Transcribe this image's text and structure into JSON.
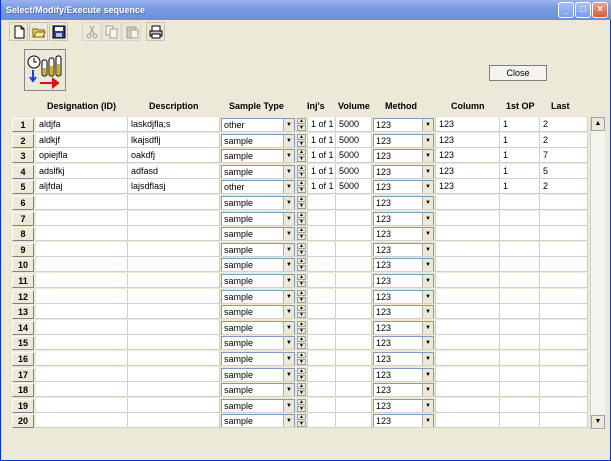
{
  "window": {
    "title": "Select/Modify/Execute sequence"
  },
  "titlebar_buttons": {
    "minimize": "_",
    "maximize": "□",
    "close": "×"
  },
  "toolbar": {
    "buttons": [
      {
        "name": "new-icon",
        "enabled": true
      },
      {
        "name": "open-icon",
        "enabled": true
      },
      {
        "name": "save-icon",
        "enabled": true
      },
      {
        "name": "cut-icon",
        "enabled": false
      },
      {
        "name": "copy-icon",
        "enabled": false
      },
      {
        "name": "paste-icon",
        "enabled": false
      },
      {
        "name": "print-icon",
        "enabled": true
      }
    ]
  },
  "close_button": {
    "label": "Close"
  },
  "columns": {
    "designation": "Designation (ID)",
    "description": "Description",
    "sample_type": "Sample Type",
    "injs": "Inj's",
    "volume": "Volume",
    "method": "Method",
    "column": "Column",
    "first_op": "1st OP",
    "last": "Last"
  },
  "rows": [
    {
      "num": "1",
      "designation": "aldjfa",
      "description": "laskdjfla;s",
      "sample_type": "other",
      "injs": "1 of 1",
      "volume": "5000",
      "method": "123",
      "column": "123",
      "first_op": "1",
      "last": "2"
    },
    {
      "num": "2",
      "designation": "aldkjf",
      "description": "lkajsdflj",
      "sample_type": "sample",
      "injs": "1 of 1",
      "volume": "5000",
      "method": "123",
      "column": "123",
      "first_op": "1",
      "last": "2"
    },
    {
      "num": "3",
      "designation": "opiejfla",
      "description": "oakdfj",
      "sample_type": "sample",
      "injs": "1 of 1",
      "volume": "5000",
      "method": "123",
      "column": "123",
      "first_op": "1",
      "last": "7"
    },
    {
      "num": "4",
      "designation": "adslfkj",
      "description": "adfasd",
      "sample_type": "sample",
      "injs": "1 of 1",
      "volume": "5000",
      "method": "123",
      "column": "123",
      "first_op": "1",
      "last": "5"
    },
    {
      "num": "5",
      "designation": "aljfdaj",
      "description": "lajsdflasj",
      "sample_type": "other",
      "injs": "1 of 1",
      "volume": "5000",
      "method": "123",
      "column": "123",
      "first_op": "1",
      "last": "2"
    },
    {
      "num": "6",
      "designation": "",
      "description": "",
      "sample_type": "sample",
      "injs": "",
      "volume": "",
      "method": "123",
      "column": "",
      "first_op": "",
      "last": ""
    },
    {
      "num": "7",
      "designation": "",
      "description": "",
      "sample_type": "sample",
      "injs": "",
      "volume": "",
      "method": "123",
      "column": "",
      "first_op": "",
      "last": ""
    },
    {
      "num": "8",
      "designation": "",
      "description": "",
      "sample_type": "sample",
      "injs": "",
      "volume": "",
      "method": "123",
      "column": "",
      "first_op": "",
      "last": ""
    },
    {
      "num": "9",
      "designation": "",
      "description": "",
      "sample_type": "sample",
      "injs": "",
      "volume": "",
      "method": "123",
      "column": "",
      "first_op": "",
      "last": ""
    },
    {
      "num": "10",
      "designation": "",
      "description": "",
      "sample_type": "sample",
      "injs": "",
      "volume": "",
      "method": "123",
      "column": "",
      "first_op": "",
      "last": ""
    },
    {
      "num": "11",
      "designation": "",
      "description": "",
      "sample_type": "sample",
      "injs": "",
      "volume": "",
      "method": "123",
      "column": "",
      "first_op": "",
      "last": ""
    },
    {
      "num": "12",
      "designation": "",
      "description": "",
      "sample_type": "sample",
      "injs": "",
      "volume": "",
      "method": "123",
      "column": "",
      "first_op": "",
      "last": ""
    },
    {
      "num": "13",
      "designation": "",
      "description": "",
      "sample_type": "sample",
      "injs": "",
      "volume": "",
      "method": "123",
      "column": "",
      "first_op": "",
      "last": ""
    },
    {
      "num": "14",
      "designation": "",
      "description": "",
      "sample_type": "sample",
      "injs": "",
      "volume": "",
      "method": "123",
      "column": "",
      "first_op": "",
      "last": ""
    },
    {
      "num": "15",
      "designation": "",
      "description": "",
      "sample_type": "sample",
      "injs": "",
      "volume": "",
      "method": "123",
      "column": "",
      "first_op": "",
      "last": ""
    },
    {
      "num": "16",
      "designation": "",
      "description": "",
      "sample_type": "sample",
      "injs": "",
      "volume": "",
      "method": "123",
      "column": "",
      "first_op": "",
      "last": ""
    },
    {
      "num": "17",
      "designation": "",
      "description": "",
      "sample_type": "sample",
      "injs": "",
      "volume": "",
      "method": "123",
      "column": "",
      "first_op": "",
      "last": ""
    },
    {
      "num": "18",
      "designation": "",
      "description": "",
      "sample_type": "sample",
      "injs": "",
      "volume": "",
      "method": "123",
      "column": "",
      "first_op": "",
      "last": ""
    },
    {
      "num": "19",
      "designation": "",
      "description": "",
      "sample_type": "sample",
      "injs": "",
      "volume": "",
      "method": "123",
      "column": "",
      "first_op": "",
      "last": ""
    },
    {
      "num": "20",
      "designation": "",
      "description": "",
      "sample_type": "sample",
      "injs": "",
      "volume": "",
      "method": "123",
      "column": "",
      "first_op": "",
      "last": ""
    }
  ],
  "scrollbar": {
    "up": "▲",
    "down": "▼"
  },
  "colors": {
    "titlebar": "#7a9be0",
    "window_bg": "#ece9d8",
    "close_red": "#d9593a"
  }
}
